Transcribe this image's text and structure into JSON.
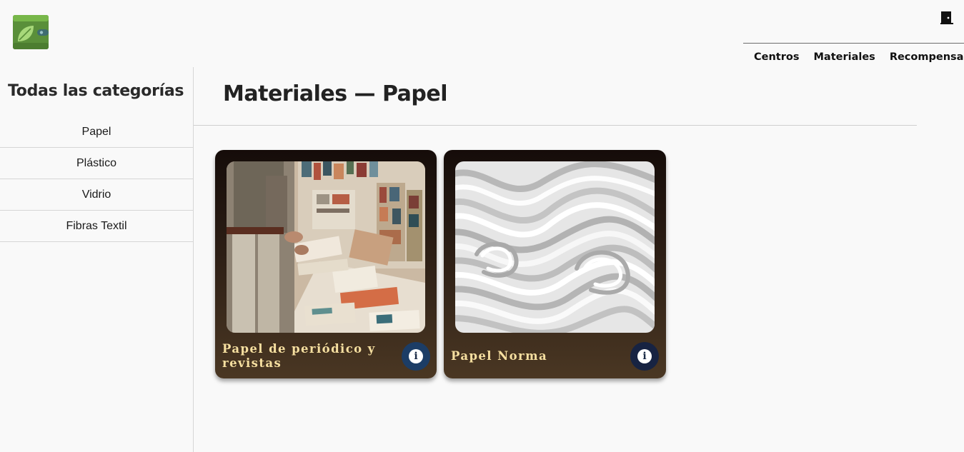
{
  "header": {
    "logo_icon": "leaf-wallet-icon",
    "exit_icon": "door-exit-icon",
    "nav": [
      {
        "label": "Centros"
      },
      {
        "label": "Materiales"
      },
      {
        "label": "Recompensas"
      }
    ]
  },
  "sidebar": {
    "title": "Todas las categorías",
    "categories": [
      {
        "label": "Papel"
      },
      {
        "label": "Plástico"
      },
      {
        "label": "Vidrio"
      },
      {
        "label": "Fibras Textil"
      }
    ]
  },
  "main": {
    "title": "Materiales — Papel",
    "cards": [
      {
        "label": "Papel de periódico y revistas",
        "image": "newspapers-photo",
        "info_icon": "info-icon"
      },
      {
        "label": "Papel Norma",
        "image": "paper-stack-photo",
        "info_icon": "info-icon"
      }
    ]
  },
  "colors": {
    "card_label": "#f6dfa0",
    "card_bg_top": "#150c09",
    "card_bg_bottom": "#4a3723",
    "logo_green": "#5a8f3a",
    "info_button_1": "#1c3d66",
    "info_button_2": "#172342"
  }
}
